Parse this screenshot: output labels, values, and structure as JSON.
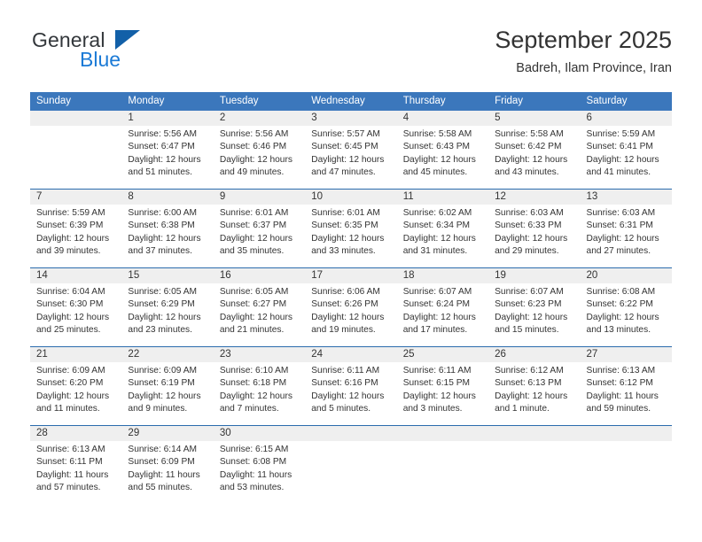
{
  "branding": {
    "logo_primary": "General",
    "logo_secondary": "Blue",
    "logo_shape": "triangle-icon"
  },
  "header": {
    "title": "September 2025",
    "subtitle": "Badreh, Ilam Province, Iran"
  },
  "calendar": {
    "weekday_headers": [
      "Sunday",
      "Monday",
      "Tuesday",
      "Wednesday",
      "Thursday",
      "Friday",
      "Saturday"
    ],
    "accent_color": "#3b77bc",
    "band_color": "#efefef",
    "weeks": [
      [
        {
          "day": "",
          "lines": []
        },
        {
          "day": "1",
          "lines": [
            "Sunrise: 5:56 AM",
            "Sunset: 6:47 PM",
            "Daylight: 12 hours",
            "and 51 minutes."
          ]
        },
        {
          "day": "2",
          "lines": [
            "Sunrise: 5:56 AM",
            "Sunset: 6:46 PM",
            "Daylight: 12 hours",
            "and 49 minutes."
          ]
        },
        {
          "day": "3",
          "lines": [
            "Sunrise: 5:57 AM",
            "Sunset: 6:45 PM",
            "Daylight: 12 hours",
            "and 47 minutes."
          ]
        },
        {
          "day": "4",
          "lines": [
            "Sunrise: 5:58 AM",
            "Sunset: 6:43 PM",
            "Daylight: 12 hours",
            "and 45 minutes."
          ]
        },
        {
          "day": "5",
          "lines": [
            "Sunrise: 5:58 AM",
            "Sunset: 6:42 PM",
            "Daylight: 12 hours",
            "and 43 minutes."
          ]
        },
        {
          "day": "6",
          "lines": [
            "Sunrise: 5:59 AM",
            "Sunset: 6:41 PM",
            "Daylight: 12 hours",
            "and 41 minutes."
          ]
        }
      ],
      [
        {
          "day": "7",
          "lines": [
            "Sunrise: 5:59 AM",
            "Sunset: 6:39 PM",
            "Daylight: 12 hours",
            "and 39 minutes."
          ]
        },
        {
          "day": "8",
          "lines": [
            "Sunrise: 6:00 AM",
            "Sunset: 6:38 PM",
            "Daylight: 12 hours",
            "and 37 minutes."
          ]
        },
        {
          "day": "9",
          "lines": [
            "Sunrise: 6:01 AM",
            "Sunset: 6:37 PM",
            "Daylight: 12 hours",
            "and 35 minutes."
          ]
        },
        {
          "day": "10",
          "lines": [
            "Sunrise: 6:01 AM",
            "Sunset: 6:35 PM",
            "Daylight: 12 hours",
            "and 33 minutes."
          ]
        },
        {
          "day": "11",
          "lines": [
            "Sunrise: 6:02 AM",
            "Sunset: 6:34 PM",
            "Daylight: 12 hours",
            "and 31 minutes."
          ]
        },
        {
          "day": "12",
          "lines": [
            "Sunrise: 6:03 AM",
            "Sunset: 6:33 PM",
            "Daylight: 12 hours",
            "and 29 minutes."
          ]
        },
        {
          "day": "13",
          "lines": [
            "Sunrise: 6:03 AM",
            "Sunset: 6:31 PM",
            "Daylight: 12 hours",
            "and 27 minutes."
          ]
        }
      ],
      [
        {
          "day": "14",
          "lines": [
            "Sunrise: 6:04 AM",
            "Sunset: 6:30 PM",
            "Daylight: 12 hours",
            "and 25 minutes."
          ]
        },
        {
          "day": "15",
          "lines": [
            "Sunrise: 6:05 AM",
            "Sunset: 6:29 PM",
            "Daylight: 12 hours",
            "and 23 minutes."
          ]
        },
        {
          "day": "16",
          "lines": [
            "Sunrise: 6:05 AM",
            "Sunset: 6:27 PM",
            "Daylight: 12 hours",
            "and 21 minutes."
          ]
        },
        {
          "day": "17",
          "lines": [
            "Sunrise: 6:06 AM",
            "Sunset: 6:26 PM",
            "Daylight: 12 hours",
            "and 19 minutes."
          ]
        },
        {
          "day": "18",
          "lines": [
            "Sunrise: 6:07 AM",
            "Sunset: 6:24 PM",
            "Daylight: 12 hours",
            "and 17 minutes."
          ]
        },
        {
          "day": "19",
          "lines": [
            "Sunrise: 6:07 AM",
            "Sunset: 6:23 PM",
            "Daylight: 12 hours",
            "and 15 minutes."
          ]
        },
        {
          "day": "20",
          "lines": [
            "Sunrise: 6:08 AM",
            "Sunset: 6:22 PM",
            "Daylight: 12 hours",
            "and 13 minutes."
          ]
        }
      ],
      [
        {
          "day": "21",
          "lines": [
            "Sunrise: 6:09 AM",
            "Sunset: 6:20 PM",
            "Daylight: 12 hours",
            "and 11 minutes."
          ]
        },
        {
          "day": "22",
          "lines": [
            "Sunrise: 6:09 AM",
            "Sunset: 6:19 PM",
            "Daylight: 12 hours",
            "and 9 minutes."
          ]
        },
        {
          "day": "23",
          "lines": [
            "Sunrise: 6:10 AM",
            "Sunset: 6:18 PM",
            "Daylight: 12 hours",
            "and 7 minutes."
          ]
        },
        {
          "day": "24",
          "lines": [
            "Sunrise: 6:11 AM",
            "Sunset: 6:16 PM",
            "Daylight: 12 hours",
            "and 5 minutes."
          ]
        },
        {
          "day": "25",
          "lines": [
            "Sunrise: 6:11 AM",
            "Sunset: 6:15 PM",
            "Daylight: 12 hours",
            "and 3 minutes."
          ]
        },
        {
          "day": "26",
          "lines": [
            "Sunrise: 6:12 AM",
            "Sunset: 6:13 PM",
            "Daylight: 12 hours",
            "and 1 minute."
          ]
        },
        {
          "day": "27",
          "lines": [
            "Sunrise: 6:13 AM",
            "Sunset: 6:12 PM",
            "Daylight: 11 hours",
            "and 59 minutes."
          ]
        }
      ],
      [
        {
          "day": "28",
          "lines": [
            "Sunrise: 6:13 AM",
            "Sunset: 6:11 PM",
            "Daylight: 11 hours",
            "and 57 minutes."
          ]
        },
        {
          "day": "29",
          "lines": [
            "Sunrise: 6:14 AM",
            "Sunset: 6:09 PM",
            "Daylight: 11 hours",
            "and 55 minutes."
          ]
        },
        {
          "day": "30",
          "lines": [
            "Sunrise: 6:15 AM",
            "Sunset: 6:08 PM",
            "Daylight: 11 hours",
            "and 53 minutes."
          ]
        },
        {
          "day": "",
          "lines": []
        },
        {
          "day": "",
          "lines": []
        },
        {
          "day": "",
          "lines": []
        },
        {
          "day": "",
          "lines": []
        }
      ]
    ]
  }
}
